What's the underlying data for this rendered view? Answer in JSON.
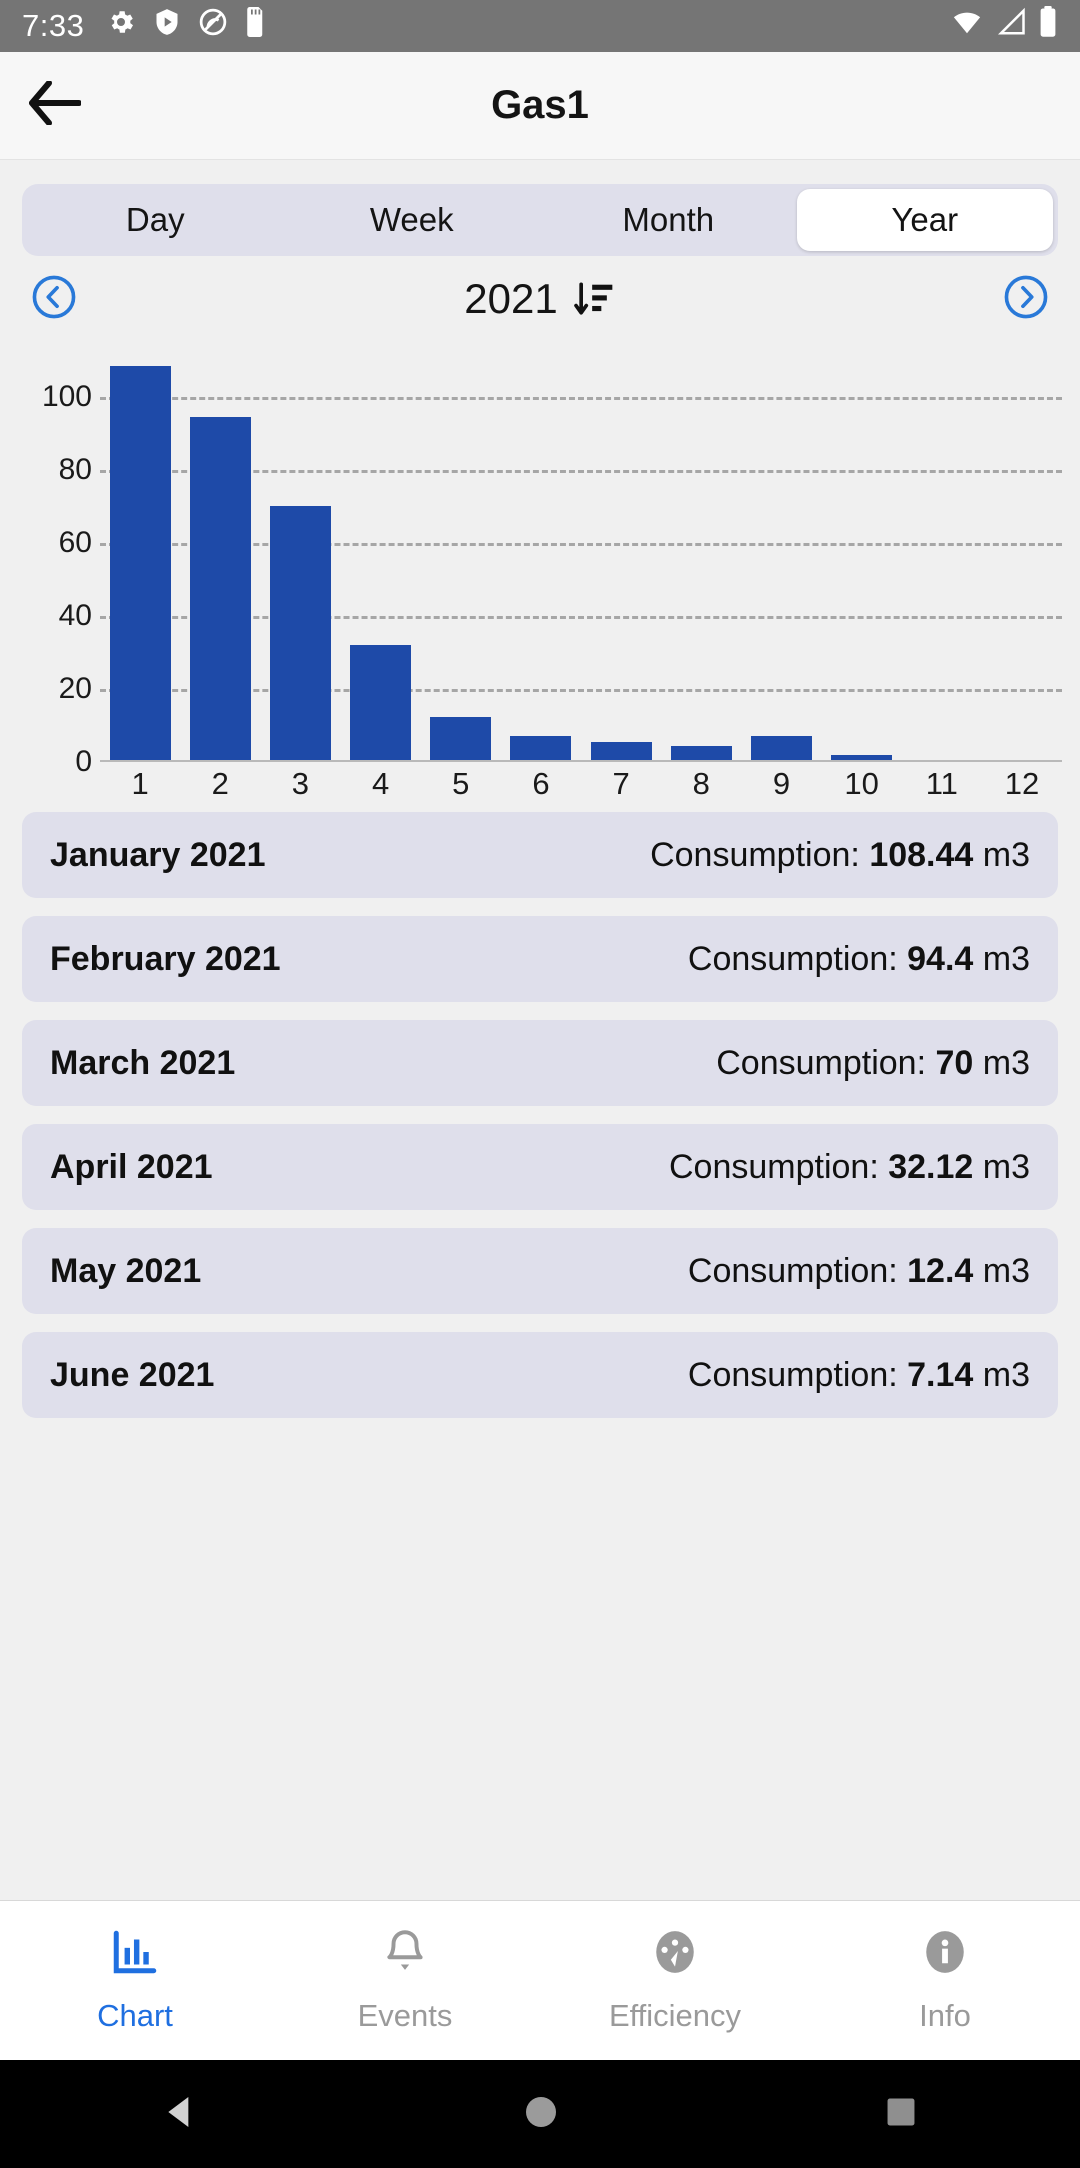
{
  "status_bar": {
    "time": "7:33",
    "left_icons": [
      "gear-icon",
      "play-shield-icon",
      "no-sound-icon",
      "sd-card-icon"
    ],
    "right_icons": [
      "wifi-icon",
      "signal-icon",
      "battery-icon"
    ],
    "background": "#757575"
  },
  "app_bar": {
    "back_icon": "back-arrow-icon",
    "title": "Gas1"
  },
  "segmented": {
    "items": [
      {
        "label": "Day",
        "active": false
      },
      {
        "label": "Week",
        "active": false
      },
      {
        "label": "Month",
        "active": false
      },
      {
        "label": "Year",
        "active": true
      }
    ]
  },
  "year_nav": {
    "prev_icon": "chevron-left-circle-icon",
    "next_icon": "chevron-right-circle-icon",
    "year": "2021",
    "sort_icon": "sort-descending-icon",
    "accent": "#2979d8"
  },
  "chart_data": {
    "type": "bar",
    "title": "",
    "xlabel": "",
    "ylabel": "",
    "categories": [
      "1",
      "2",
      "3",
      "4",
      "5",
      "6",
      "7",
      "8",
      "9",
      "10",
      "11",
      "12"
    ],
    "values": [
      108.44,
      94.4,
      70,
      32.12,
      12.4,
      7.14,
      5.5,
      4.5,
      7,
      1.8,
      0,
      0
    ],
    "yticks": [
      0,
      20,
      40,
      60,
      80,
      100
    ],
    "ylim": [
      0,
      115
    ],
    "grid": true,
    "grid_style": "dashed",
    "bar_color": "#1e4aa8",
    "legend": "none"
  },
  "list": {
    "rows": [
      {
        "month": "January 2021",
        "prefix": "Consumption: ",
        "value": "108.44",
        "unit": " m3"
      },
      {
        "month": "February 2021",
        "prefix": "Consumption: ",
        "value": "94.4",
        "unit": " m3"
      },
      {
        "month": "March 2021",
        "prefix": "Consumption: ",
        "value": "70",
        "unit": " m3"
      },
      {
        "month": "April 2021",
        "prefix": "Consumption: ",
        "value": "32.12",
        "unit": " m3"
      },
      {
        "month": "May 2021",
        "prefix": "Consumption: ",
        "value": "12.4",
        "unit": " m3"
      },
      {
        "month": "June 2021",
        "prefix": "Consumption: ",
        "value": "7.14",
        "unit": " m3"
      }
    ]
  },
  "bottom_nav": {
    "items": [
      {
        "label": "Chart",
        "icon": "bar-chart-icon",
        "active": true
      },
      {
        "label": "Events",
        "icon": "bell-icon",
        "active": false
      },
      {
        "label": "Efficiency",
        "icon": "gauge-icon",
        "active": false
      },
      {
        "label": "Info",
        "icon": "info-icon",
        "active": false
      }
    ],
    "active_color": "#1f6fe0",
    "inactive_color": "#9a9a9a"
  },
  "system_nav": {
    "icons": [
      "back-triangle-icon",
      "home-circle-icon",
      "recents-square-icon"
    ]
  }
}
